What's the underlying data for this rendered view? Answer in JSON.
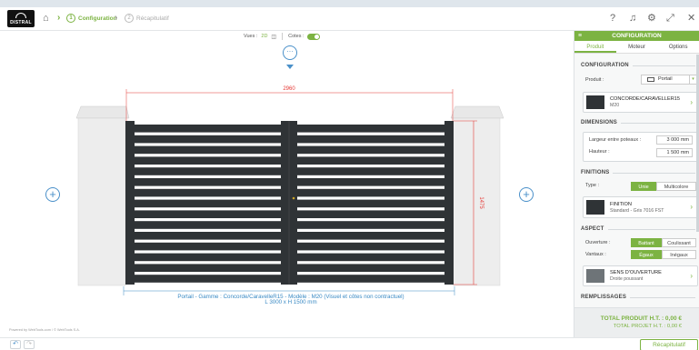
{
  "header": {
    "logo_text": "DISTRAL",
    "steps": [
      {
        "num": "1",
        "label": "Configuration"
      },
      {
        "num": "2",
        "label": "Récapitulatif"
      }
    ]
  },
  "toolbar": {
    "views_label": "Vues :",
    "views_value": "2D",
    "dims_label": "Cotes :"
  },
  "gate": {
    "width_label": "2960",
    "height_label": "1475",
    "caption_line1": "Portail - Gamme : Concorde/CaravelleR15 - Modèle : M20 (Visuel et côtes non contractuel)",
    "caption_line2": "L 3000 x H 1500 mm",
    "powered": "Powered by WebTools.com / © WebTools S.A."
  },
  "panel": {
    "title": "CONFIGURATION",
    "tabs": [
      "Produit",
      "Moteur",
      "Options"
    ],
    "config_section": "CONFIGURATION",
    "product_label": "Produit :",
    "product_value": "Portail",
    "model_name": "CONCORDE/CARAVELLER15",
    "model_sub": "M20",
    "dims_section": "DIMENSIONS",
    "width_label": "Largeur entre poteaux :",
    "width_value": "3 000 mm",
    "height_label": "Hauteur :",
    "height_value": "1 500 mm",
    "finish_section": "FINITIONS",
    "type_label": "Type :",
    "type_options": [
      "Unie",
      "Multicolore"
    ],
    "finish_name": "FINITION",
    "finish_sub": "Standard - Gris 7016 FST",
    "aspect_section": "ASPECT",
    "opening_label": "Ouverture :",
    "opening_options": [
      "Battant",
      "Coulissant"
    ],
    "leaves_label": "Vantaux :",
    "leaves_options": [
      "Égaux",
      "Inégaux"
    ],
    "direction_name": "SENS D'OUVERTURE",
    "direction_sub": "Droite poussant",
    "fill_section": "REMPLISSAGES",
    "total_product": "TOTAL PRODUIT H.T. : 0,00 €",
    "total_project": "TOTAL PROJET H.T. : 0,00 €"
  },
  "footer": {
    "recap_button": "Récapitulatif"
  },
  "colors": {
    "accent": "#7cb342",
    "dimension": "#e53935",
    "link": "#3a8ac4",
    "gate": "#2f3336"
  }
}
